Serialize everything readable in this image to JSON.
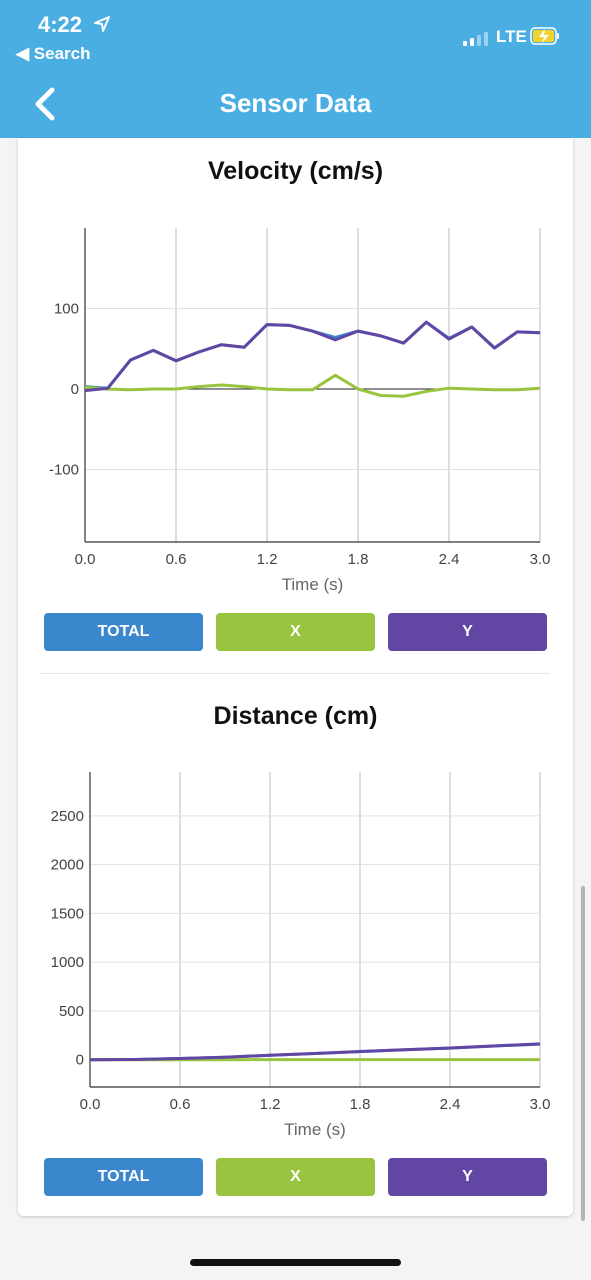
{
  "status_bar": {
    "time": "4:22",
    "back_app": "◀ Search",
    "network": "LTE"
  },
  "nav": {
    "title": "Sensor Data",
    "back_icon": "chevron-left-icon"
  },
  "buttons": {
    "total": "TOTAL",
    "x": "X",
    "y": "Y"
  },
  "colors": {
    "header": "#4aaee3",
    "total": "#3a87ce",
    "x": "#98c43f",
    "y": "#6147a3"
  },
  "chart_data": [
    {
      "type": "line",
      "title": "Velocity (cm/s)",
      "xlabel": "Time (s)",
      "xlim": [
        0,
        3
      ],
      "ylim": [
        -190,
        200
      ],
      "x_ticks": [
        "0.0",
        "0.6",
        "1.2",
        "1.8",
        "2.4",
        "3.0"
      ],
      "y_ticks": [
        {
          "v": 100,
          "label": "100"
        },
        {
          "v": 0,
          "label": "0"
        },
        {
          "v": -100,
          "label": "-100"
        }
      ],
      "x": [
        0,
        0.15,
        0.3,
        0.45,
        0.6,
        0.75,
        0.9,
        1.05,
        1.2,
        1.35,
        1.5,
        1.65,
        1.8,
        1.95,
        2.1,
        2.25,
        2.4,
        2.55,
        2.7,
        2.85,
        3.0
      ],
      "series": [
        {
          "name": "TOTAL",
          "color": "#3a87ce",
          "values": [
            3,
            1,
            36,
            48,
            35,
            46,
            55,
            52,
            80,
            79,
            72,
            64,
            72,
            66,
            57,
            83,
            63,
            77,
            51,
            71,
            70
          ]
        },
        {
          "name": "X",
          "color": "#98c43f",
          "values": [
            2,
            0,
            -1,
            0,
            0,
            3,
            5,
            3,
            0,
            -1,
            -1,
            17,
            0,
            -8,
            -9,
            -3,
            1,
            0,
            -1,
            -1,
            1
          ]
        },
        {
          "name": "Y",
          "color": "#6147a3",
          "values": [
            -2,
            1,
            36,
            48,
            35,
            46,
            55,
            52,
            80,
            79,
            72,
            61,
            72,
            66,
            57,
            83,
            62,
            77,
            51,
            71,
            70
          ]
        }
      ]
    },
    {
      "type": "line",
      "title": "Distance (cm)",
      "xlabel": "Time (s)",
      "xlim": [
        0,
        3
      ],
      "ylim": [
        -280,
        2950
      ],
      "x_ticks": [
        "0.0",
        "0.6",
        "1.2",
        "1.8",
        "2.4",
        "3.0"
      ],
      "y_ticks": [
        {
          "v": 2500,
          "label": "2500"
        },
        {
          "v": 2000,
          "label": "2000"
        },
        {
          "v": 1500,
          "label": "1500"
        },
        {
          "v": 1000,
          "label": "1000"
        },
        {
          "v": 500,
          "label": "500"
        },
        {
          "v": 0,
          "label": "0"
        }
      ],
      "x": [
        0,
        0.3,
        0.6,
        0.9,
        1.2,
        1.5,
        1.8,
        2.1,
        2.4,
        2.7,
        3.0
      ],
      "series": [
        {
          "name": "TOTAL",
          "color": "#3a87ce",
          "values": [
            0,
            2,
            12,
            26,
            45,
            64,
            83,
            101,
            119,
            140,
            160
          ]
        },
        {
          "name": "X",
          "color": "#98c43f",
          "values": [
            0,
            0,
            0,
            0,
            1,
            1,
            1,
            1,
            1,
            1,
            1
          ]
        },
        {
          "name": "Y",
          "color": "#6147a3",
          "values": [
            0,
            2,
            12,
            26,
            45,
            64,
            84,
            102,
            120,
            141,
            162
          ]
        }
      ]
    }
  ]
}
